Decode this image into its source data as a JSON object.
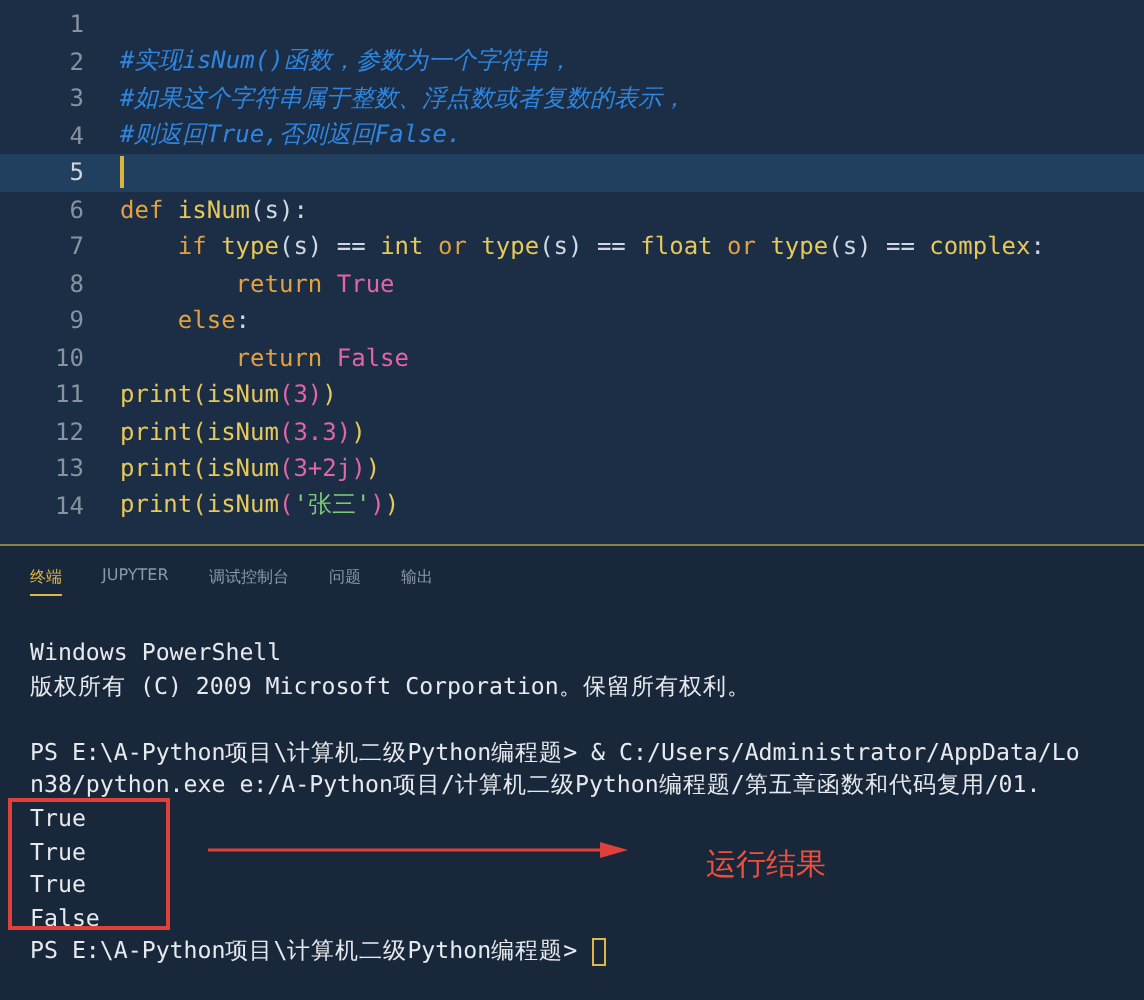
{
  "editor": {
    "lines": [
      {
        "number": "1",
        "current": false
      },
      {
        "number": "2",
        "current": false,
        "tokens": [
          {
            "text": "#实现isNum()函数，参数为一个字符串，",
            "kind": "comment"
          }
        ]
      },
      {
        "number": "3",
        "current": false,
        "tokens": [
          {
            "text": "#如果这个字符串属于整数、浮点数或者复数的表示，",
            "kind": "comment"
          }
        ]
      },
      {
        "number": "4",
        "current": false,
        "tokens": [
          {
            "text": "#则返回True,否则返回False.",
            "kind": "comment"
          }
        ]
      },
      {
        "number": "5",
        "current": true
      },
      {
        "number": "6",
        "current": false,
        "tokens": [
          {
            "text": "def",
            "kind": "keyword"
          },
          {
            "text": " isNum",
            "kind": "function"
          },
          {
            "text": "(s):",
            "kind": "plain"
          }
        ]
      },
      {
        "number": "7",
        "current": false,
        "tokens": [
          {
            "text": "    if",
            "kind": "keyword"
          },
          {
            "text": " type",
            "kind": "function"
          },
          {
            "text": "(s) ==",
            "kind": "plain"
          },
          {
            "text": " int",
            "kind": "function"
          },
          {
            "text": " or",
            "kind": "keyword"
          },
          {
            "text": " type",
            "kind": "function"
          },
          {
            "text": "(s) ==",
            "kind": "plain"
          },
          {
            "text": " float",
            "kind": "function"
          },
          {
            "text": " or",
            "kind": "keyword"
          },
          {
            "text": " type",
            "kind": "function"
          },
          {
            "text": "(s) ==",
            "kind": "plain"
          },
          {
            "text": " complex",
            "kind": "function"
          },
          {
            "text": ":",
            "kind": "plain"
          }
        ]
      },
      {
        "number": "8",
        "current": false,
        "tokens": [
          {
            "text": "        return",
            "kind": "keyword"
          },
          {
            "text": " True",
            "kind": "constant"
          }
        ]
      },
      {
        "number": "9",
        "current": false,
        "tokens": [
          {
            "text": "    else",
            "kind": "keyword"
          },
          {
            "text": ":",
            "kind": "plain"
          }
        ]
      },
      {
        "number": "10",
        "current": false,
        "tokens": [
          {
            "text": "        return",
            "kind": "keyword"
          },
          {
            "text": " False",
            "kind": "constant"
          }
        ]
      },
      {
        "number": "11",
        "current": false,
        "tokens": [
          {
            "text": "print(isNum",
            "kind": "function"
          },
          {
            "text": "(3)",
            "kind": "constant"
          },
          {
            "text": ")",
            "kind": "function"
          }
        ]
      },
      {
        "number": "12",
        "current": false,
        "tokens": [
          {
            "text": "print(isNum",
            "kind": "function"
          },
          {
            "text": "(3.3)",
            "kind": "constant"
          },
          {
            "text": ")",
            "kind": "function"
          }
        ]
      },
      {
        "number": "13",
        "current": false,
        "tokens": [
          {
            "text": "print(isNum",
            "kind": "function"
          },
          {
            "text": "(3+2j)",
            "kind": "constant"
          },
          {
            "text": ")",
            "kind": "function"
          }
        ]
      },
      {
        "number": "14",
        "current": false,
        "tokens": [
          {
            "text": "print(isNum",
            "kind": "function"
          },
          {
            "text": "(",
            "kind": "constant"
          },
          {
            "text": "'张三'",
            "kind": "string"
          },
          {
            "text": ")",
            "kind": "constant"
          },
          {
            "text": ")",
            "kind": "function"
          }
        ]
      }
    ]
  },
  "panel": {
    "tabs": [
      {
        "label": "终端",
        "selected": true
      },
      {
        "label": "JUPYTER",
        "selected": false
      },
      {
        "label": "调试控制台",
        "selected": false
      },
      {
        "label": "问题",
        "selected": false
      },
      {
        "label": "输出",
        "selected": false
      }
    ],
    "terminal_lines": [
      "Windows PowerShell",
      "版权所有 (C) 2009 Microsoft Corporation。保留所有权利。",
      "PS E:\\A-Python项目\\计算机二级Python编程题> & C:/Users/Administrator/AppData/Lo",
      "n38/python.exe e:/A-Python项目/计算机二级Python编程题/第五章函数和代码复用/01.",
      "True",
      "True",
      "True",
      "False"
    ],
    "prompt": "PS E:\\A-Python项目\\计算机二级Python编程题> "
  },
  "annotation": {
    "label": "运行结果"
  }
}
